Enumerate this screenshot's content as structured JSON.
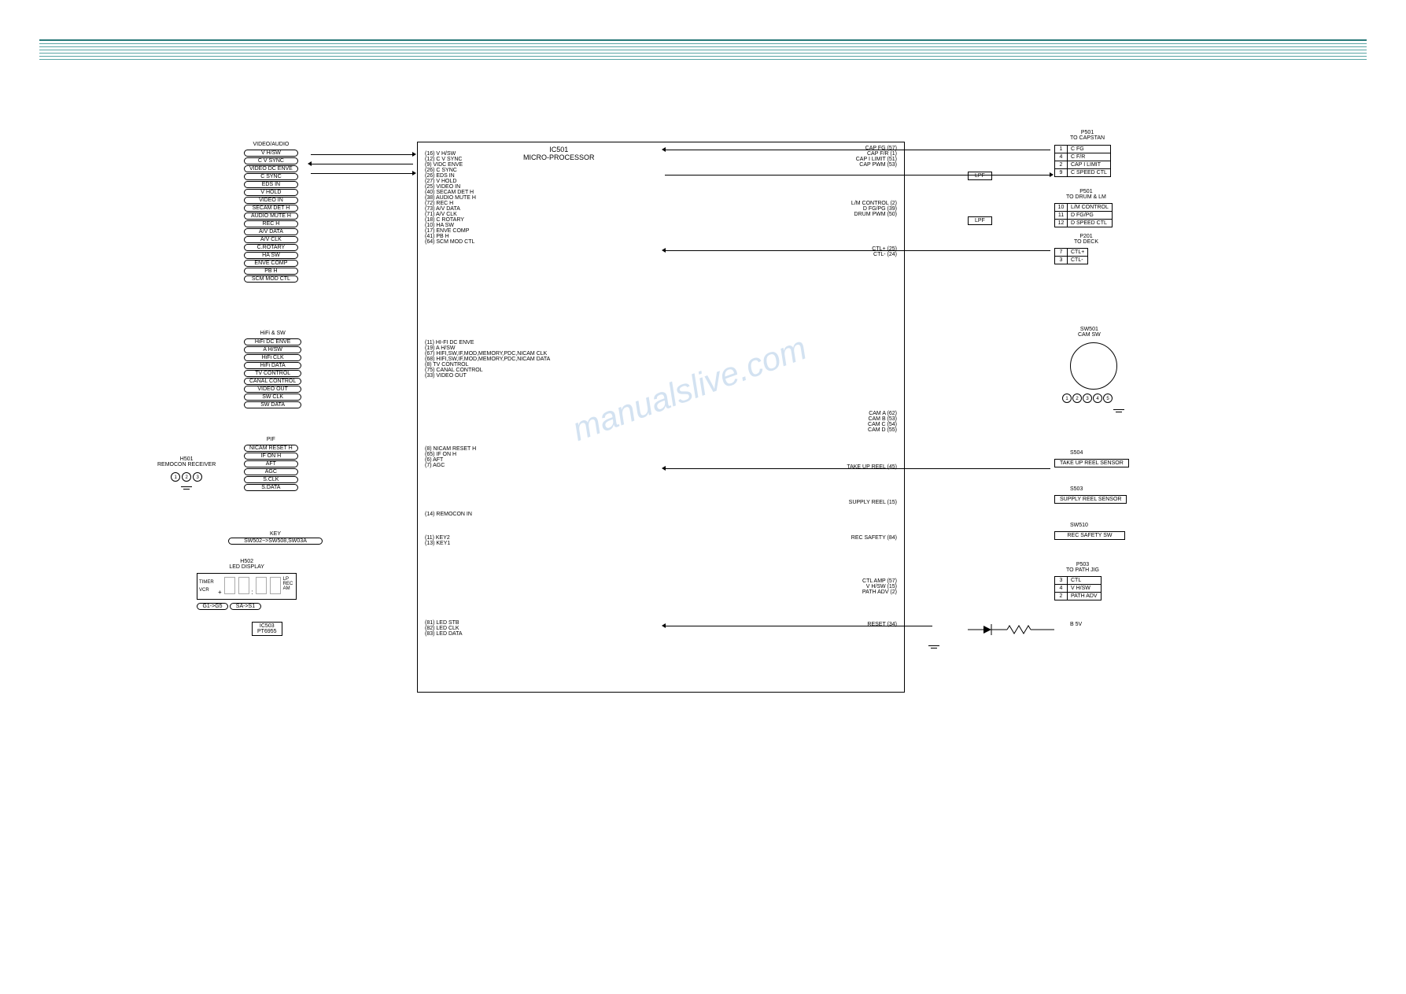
{
  "ic": {
    "ref": "IC501",
    "name": "MICRO-PROCESSOR"
  },
  "groups": {
    "video_audio": {
      "title": "VIDEO/AUDIO",
      "signals": [
        "V H/SW",
        "C V SYNC",
        "VIDEO DC ENVE",
        "C SYNC",
        "EDS IN",
        "V HOLD",
        "VIDEO IN",
        "SECAM DET H",
        "AUDIO MUTE H",
        "REC H",
        "A/V DATA",
        "A/V CLK",
        "C.ROTARY",
        "HA SW",
        "ENVE COMP",
        "PB H",
        "SCM MOD CTL"
      ],
      "pins": [
        "(16) V H/SW",
        "(12) C V SYNC",
        "(9) VIDC ENVE",
        "(26) C SYNC",
        "(26) EDS IN",
        "(27) V HOLD",
        "(25) VIDEO IN",
        "(40) SECAM DET H",
        "(38) AUDIO MUTE H",
        "(72) REC H",
        "(73) A/V DATA",
        "(71) A/V CLK",
        "(18) C ROTARY",
        "(10) HA SW",
        "(17) ENVE COMP",
        "(41) PB H",
        "(64) SCM MOD CTL"
      ]
    },
    "hifi_sw": {
      "title": "HiFi & SW",
      "signals": [
        "HiFi DC ENVE",
        "A H/SW",
        "HiFi CLK",
        "HiFi DATA",
        "TV CONTROL",
        "CANAL CONTROL",
        "VIDEO OUT",
        "SW CLK",
        "SW DATA"
      ],
      "pins": [
        "(11) HI-FI DC ENVE",
        "(19) A H/SW",
        "(67) HIFI,SW,IF,MOD,MEMORY,PDC,NICAM CLK",
        "(68) HIFI,SW,IF,MOD,MEMORY,PDC,NICAM DATA",
        "(8) TV CONTROL",
        "(75) CANAL CONTROL",
        "(33) VIDEO OUT"
      ]
    },
    "pif": {
      "title": "PIF",
      "signals": [
        "NICAM RESET H",
        "IF ON H",
        "AFT",
        "AGC",
        "S.CLK",
        "S.DATA"
      ],
      "pins": [
        "(8) NICAM RESET H",
        "(65) IF ON H",
        "(6) AFT",
        "(7) AGC"
      ]
    },
    "key": {
      "title": "KEY",
      "subtitle": "SW502~>SW508,SW03A",
      "pins": [
        "(11) KEY2",
        "(13) KEY1"
      ]
    },
    "remocon": {
      "title": "H501",
      "subtitle": "REMOCON RECEIVER",
      "pin": "(14) REMOCON IN"
    },
    "led": {
      "title": "H502",
      "subtitle": "LED DISPLAY",
      "ic": "IC503",
      "ic_part": "PT6955",
      "labels": [
        "TIMER",
        "VCR",
        "LP",
        "REC",
        "AM"
      ],
      "grids": [
        "G1->G5",
        "SA->S1"
      ],
      "pins": [
        "(81) LED STB",
        "(82) LED CLK",
        "(83) LED DATA"
      ]
    }
  },
  "right_outputs": {
    "capstan_pins": [
      "CAP FG (57)",
      "CAP F/R (1)",
      "CAP I LIMIT (51)",
      "CAP PWM (53)"
    ],
    "drum_pins": [
      "L/M CONTROL (2)",
      "D FG/PG (39)",
      "DRUM PWM (50)"
    ],
    "ctl_pins": [
      "CTL+ (25)",
      "CTL- (24)"
    ],
    "cam_pins": [
      "CAM A (62)",
      "CAM B (53)",
      "CAM C (54)",
      "CAM D (55)"
    ],
    "reel_pins": [
      "TAKE UP REEL (45)",
      "SUPPLY REEL (15)",
      "REC SAFETY (84)"
    ],
    "path_pins": [
      "CTL AMP (57)",
      "V H/SW (15)",
      "PATH ADV (2)"
    ],
    "reset_pin": "RESET (34)"
  },
  "lpf": "LPF",
  "connectors": {
    "p501_capstan": {
      "title": "P501",
      "sub": "TO CAPSTAN",
      "rows": [
        [
          "1",
          "C FG"
        ],
        [
          "4",
          "C F/R"
        ],
        [
          "2",
          "CAP I LIMIT"
        ],
        [
          "9",
          "C SPEED CTL"
        ]
      ]
    },
    "p501_drum": {
      "title": "P501",
      "sub": "TO DRUM & LM",
      "rows": [
        [
          "10",
          "L/M CONTROL"
        ],
        [
          "11",
          "D FG/PG"
        ],
        [
          "12",
          "D SPEED CTL"
        ]
      ]
    },
    "p201_deck": {
      "title": "P201",
      "sub": "TO DECK",
      "rows": [
        [
          "7",
          "CTL+"
        ],
        [
          "3",
          "CTL-"
        ]
      ]
    },
    "p503_path": {
      "title": "P503",
      "sub": "TO PATH JIG",
      "rows": [
        [
          "3",
          "CTL"
        ],
        [
          "4",
          "V H/SW"
        ],
        [
          "2",
          "PATH ADV"
        ]
      ]
    }
  },
  "switches": {
    "cam": {
      "ref": "SW501",
      "name": "CAM SW",
      "terms": [
        "1",
        "2",
        "3",
        "4",
        "5"
      ]
    },
    "takeup": {
      "ref": "S504",
      "name": "TAKE UP REEL SENSOR"
    },
    "supply": {
      "ref": "S503",
      "name": "SUPPLY REEL SENSOR"
    },
    "recsafety": {
      "ref": "SW510",
      "name": "REC SAFETY SW"
    }
  },
  "power": "B 5V",
  "watermark": "manualslive.com"
}
